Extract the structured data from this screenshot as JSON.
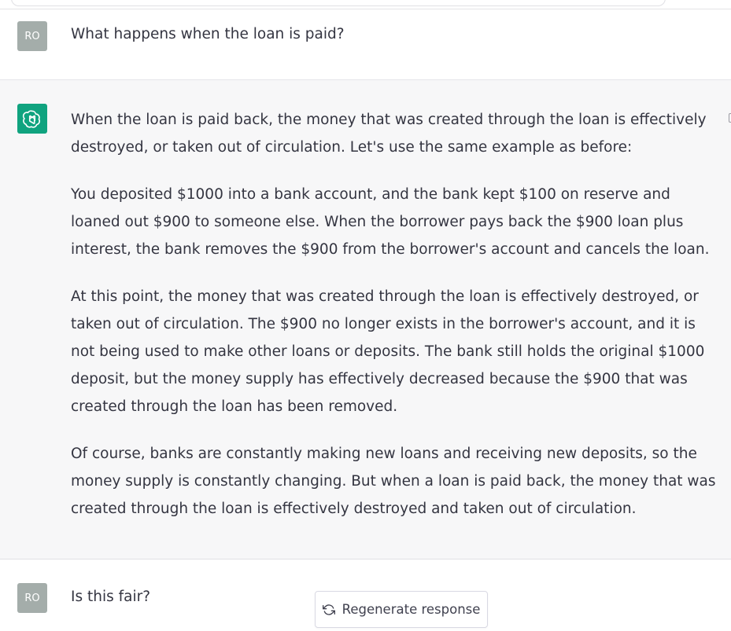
{
  "conversation": {
    "user_message_1": {
      "avatar_initials": "RO",
      "text": "What happens when the loan is paid?"
    },
    "assistant_message": {
      "avatar_icon": "openai-logo-icon",
      "paragraphs": [
        "When the loan is paid back, the money that was created through the loan is effectively destroyed, or taken out of circulation. Let's use the same example as before:",
        "You deposited $1000 into a bank account, and the bank kept $100 on reserve and loaned out $900 to someone else. When the borrower pays back the $900 loan plus interest, the bank removes the $900 from the borrower's account and cancels the loan.",
        "At this point, the money that was created through the loan is effectively destroyed, or taken out of circulation. The $900 no longer exists in the borrower's account, and it is not being used to make other loans or deposits. The bank still holds the original $1000 deposit, but the money supply has effectively decreased because the $900 that was created through the loan has been removed.",
        "Of course, banks are constantly making new loans and receiving new deposits, so the money supply is constantly changing. But when a loan is paid back, the money that was created through the loan is effectively destroyed and taken out of circulation."
      ]
    },
    "user_message_2": {
      "avatar_initials": "RO",
      "text": "Is this fair?"
    }
  },
  "controls": {
    "regenerate_label": "Regenerate response",
    "regenerate_icon": "refresh-icon"
  },
  "colors": {
    "assistant_bg": "#f7f7f8",
    "gpt_avatar": "#10a37f",
    "user_avatar": "#a4adaa",
    "text": "#343541"
  }
}
